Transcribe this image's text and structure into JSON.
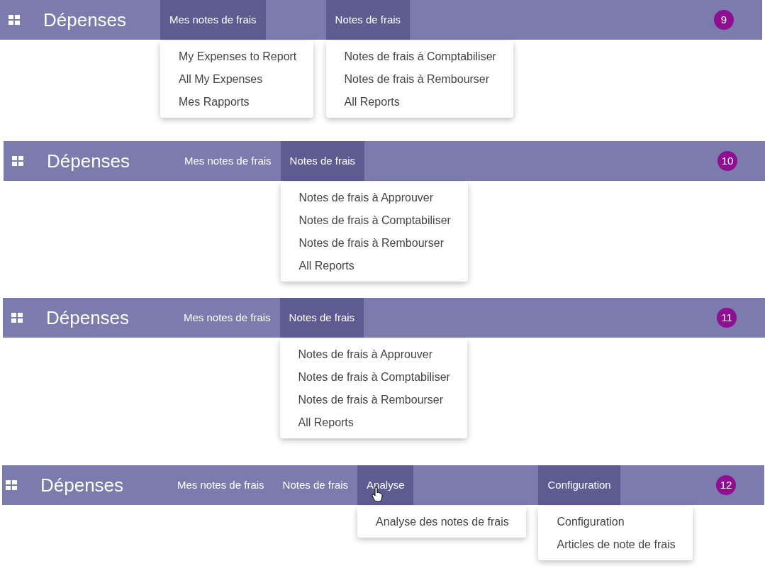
{
  "panels": [
    {
      "app_title": "Dépenses",
      "badge": "9",
      "menus": [
        {
          "label": "Mes notes de frais",
          "selected": true,
          "items": [
            "My Expenses to Report",
            "All My Expenses",
            "Mes Rapports"
          ]
        },
        {
          "label": "Notes de frais",
          "selected": true,
          "items": [
            "Notes de frais à Comptabiliser",
            "Notes de frais à Rembourser",
            "All Reports"
          ]
        }
      ]
    },
    {
      "app_title": "Dépenses",
      "badge": "10",
      "menus": [
        {
          "label": "Mes notes de frais",
          "selected": false
        },
        {
          "label": "Notes de frais",
          "selected": true,
          "items": [
            "Notes de frais à Approuver",
            "Notes de frais à Comptabiliser",
            "Notes de frais à Rembourser",
            "All Reports"
          ]
        }
      ]
    },
    {
      "app_title": "Dépenses",
      "badge": "11",
      "menus": [
        {
          "label": "Mes notes de frais",
          "selected": false
        },
        {
          "label": "Notes de frais",
          "selected": true,
          "items": [
            "Notes de frais à Approuver",
            "Notes de frais à Comptabiliser",
            "Notes de frais à Rembourser",
            "All Reports"
          ]
        }
      ]
    },
    {
      "app_title": "Dépenses",
      "badge": "12",
      "menus": [
        {
          "label": "Mes notes de frais",
          "selected": false
        },
        {
          "label": "Notes de frais",
          "selected": false
        },
        {
          "label": "Analyse",
          "selected": true,
          "cursor": true,
          "items": [
            "Analyse des notes de frais"
          ]
        },
        {
          "label": "Configuration",
          "selected": true,
          "items": [
            "Configuration",
            "Articles de note de frais"
          ]
        }
      ]
    }
  ]
}
